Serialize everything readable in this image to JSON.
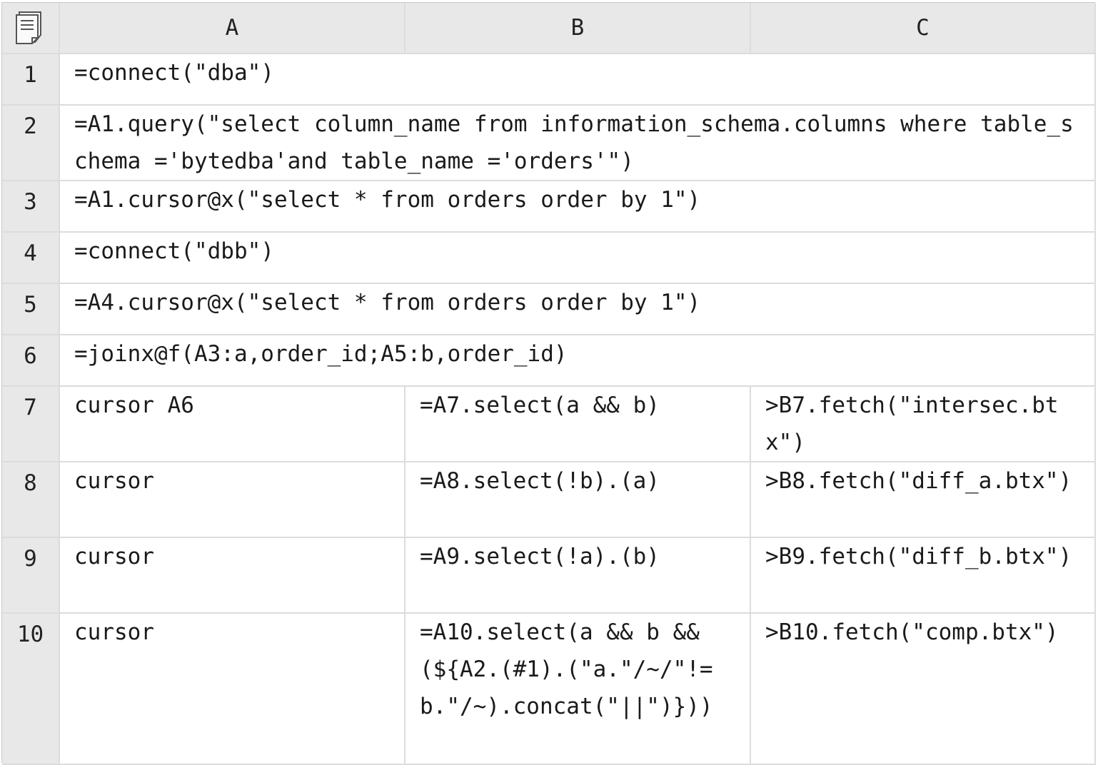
{
  "columns": [
    "A",
    "B",
    "C"
  ],
  "rows": [
    {
      "num": "1",
      "a": "=connect(\"dba\")"
    },
    {
      "num": "2",
      "a": "=A1.query(\"select column_name from information_schema.columns where table_schema ='bytedba'and table_name ='orders'\")"
    },
    {
      "num": "3",
      "a": "=A1.cursor@x(\"select * from orders order by 1\")"
    },
    {
      "num": "4",
      "a": "=connect(\"dbb\")"
    },
    {
      "num": "5",
      "a": "=A4.cursor@x(\"select * from orders order by 1\")"
    },
    {
      "num": "6",
      "a": "=joinx@f(A3:a,order_id;A5:b,order_id)"
    },
    {
      "num": "7",
      "a": "cursor A6",
      "b": "=A7.select(a && b)",
      "c": ">B7.fetch(\"intersec.btx\")"
    },
    {
      "num": "8",
      "a": "cursor",
      "b": "=A8.select(!b).(a)",
      "c": ">B8.fetch(\"diff_a.btx\")"
    },
    {
      "num": "9",
      "a": "cursor",
      "b": "=A9.select(!a).(b)",
      "c": ">B9.fetch(\"diff_b.btx\")"
    },
    {
      "num": "10",
      "a": "cursor",
      "b": "=A10.select(a && b && (${A2.(#1).(\"a.\"/~/\"!=b.\"/~).concat(\"||\")}))",
      "c": ">B10.fetch(\"comp.btx\")"
    }
  ],
  "icons": {
    "corner": "document-icon"
  }
}
